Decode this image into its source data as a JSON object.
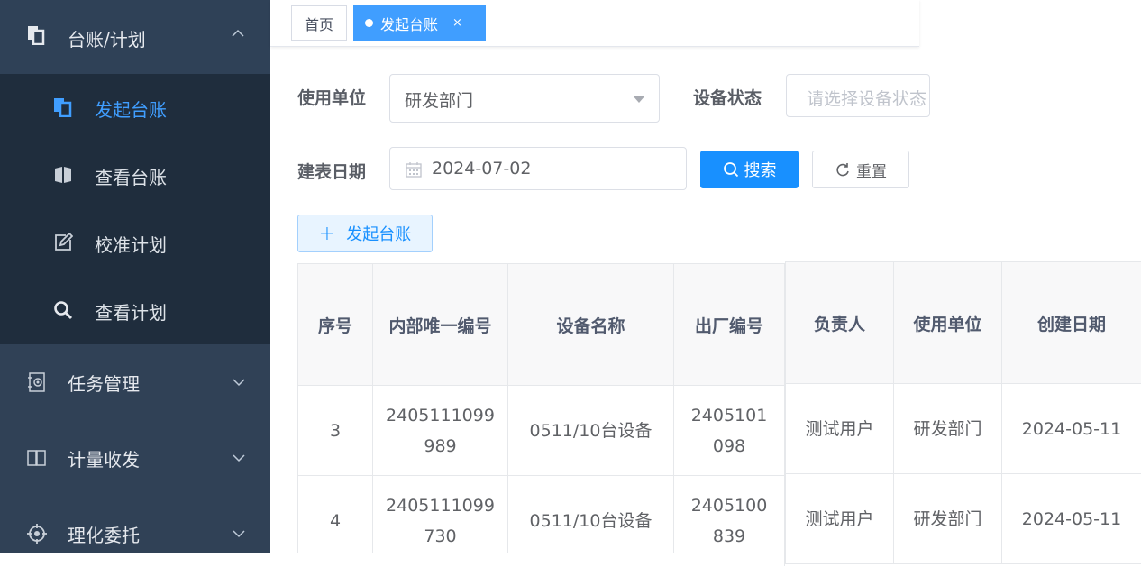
{
  "sidebar": {
    "group": {
      "label": "台账/计划",
      "icon": "document-copy-icon"
    },
    "subitems": [
      {
        "label": "发起台账",
        "icon": "document-copy-icon",
        "active": true
      },
      {
        "label": "查看台账",
        "icon": "book-icon",
        "active": false
      },
      {
        "label": "校准计划",
        "icon": "edit-icon",
        "active": false
      },
      {
        "label": "查看计划",
        "icon": "search-icon",
        "active": false
      }
    ],
    "items": [
      {
        "label": "任务管理",
        "icon": "task-icon"
      },
      {
        "label": "计量收发",
        "icon": "open-book-icon"
      },
      {
        "label": "理化委托",
        "icon": "target-icon"
      }
    ]
  },
  "tags": {
    "home": "首页",
    "active": "发起台账",
    "close": "×"
  },
  "form": {
    "unit_label": "使用单位",
    "unit_value": "研发部门",
    "status_label": "设备状态",
    "status_placeholder": "请选择设备状态",
    "date_label": "建表日期",
    "date_value": "2024-07-02",
    "search_label": "搜索",
    "reset_label": "重置",
    "add_label": "发起台账"
  },
  "table_left": {
    "headers": [
      "序号",
      "内部唯一编号",
      "设备名称",
      "出厂编号"
    ],
    "rows": [
      {
        "seq": "3",
        "internal_no_1": "2405111099",
        "internal_no_2": "989",
        "name": "0511/10台设备",
        "factory_no_1": "2405101",
        "factory_no_2": "098"
      },
      {
        "seq": "4",
        "internal_no_1": "2405111099",
        "internal_no_2": "730",
        "name": "0511/10台设备",
        "factory_no_1": "2405100",
        "factory_no_2": "839"
      }
    ]
  },
  "table_right": {
    "headers": [
      "负责人",
      "使用单位",
      "创建日期"
    ],
    "rows": [
      {
        "owner": "测试用户",
        "unit": "研发部门",
        "date": "2024-05-11"
      },
      {
        "owner": "测试用户",
        "unit": "研发部门",
        "date": "2024-05-11"
      }
    ]
  }
}
